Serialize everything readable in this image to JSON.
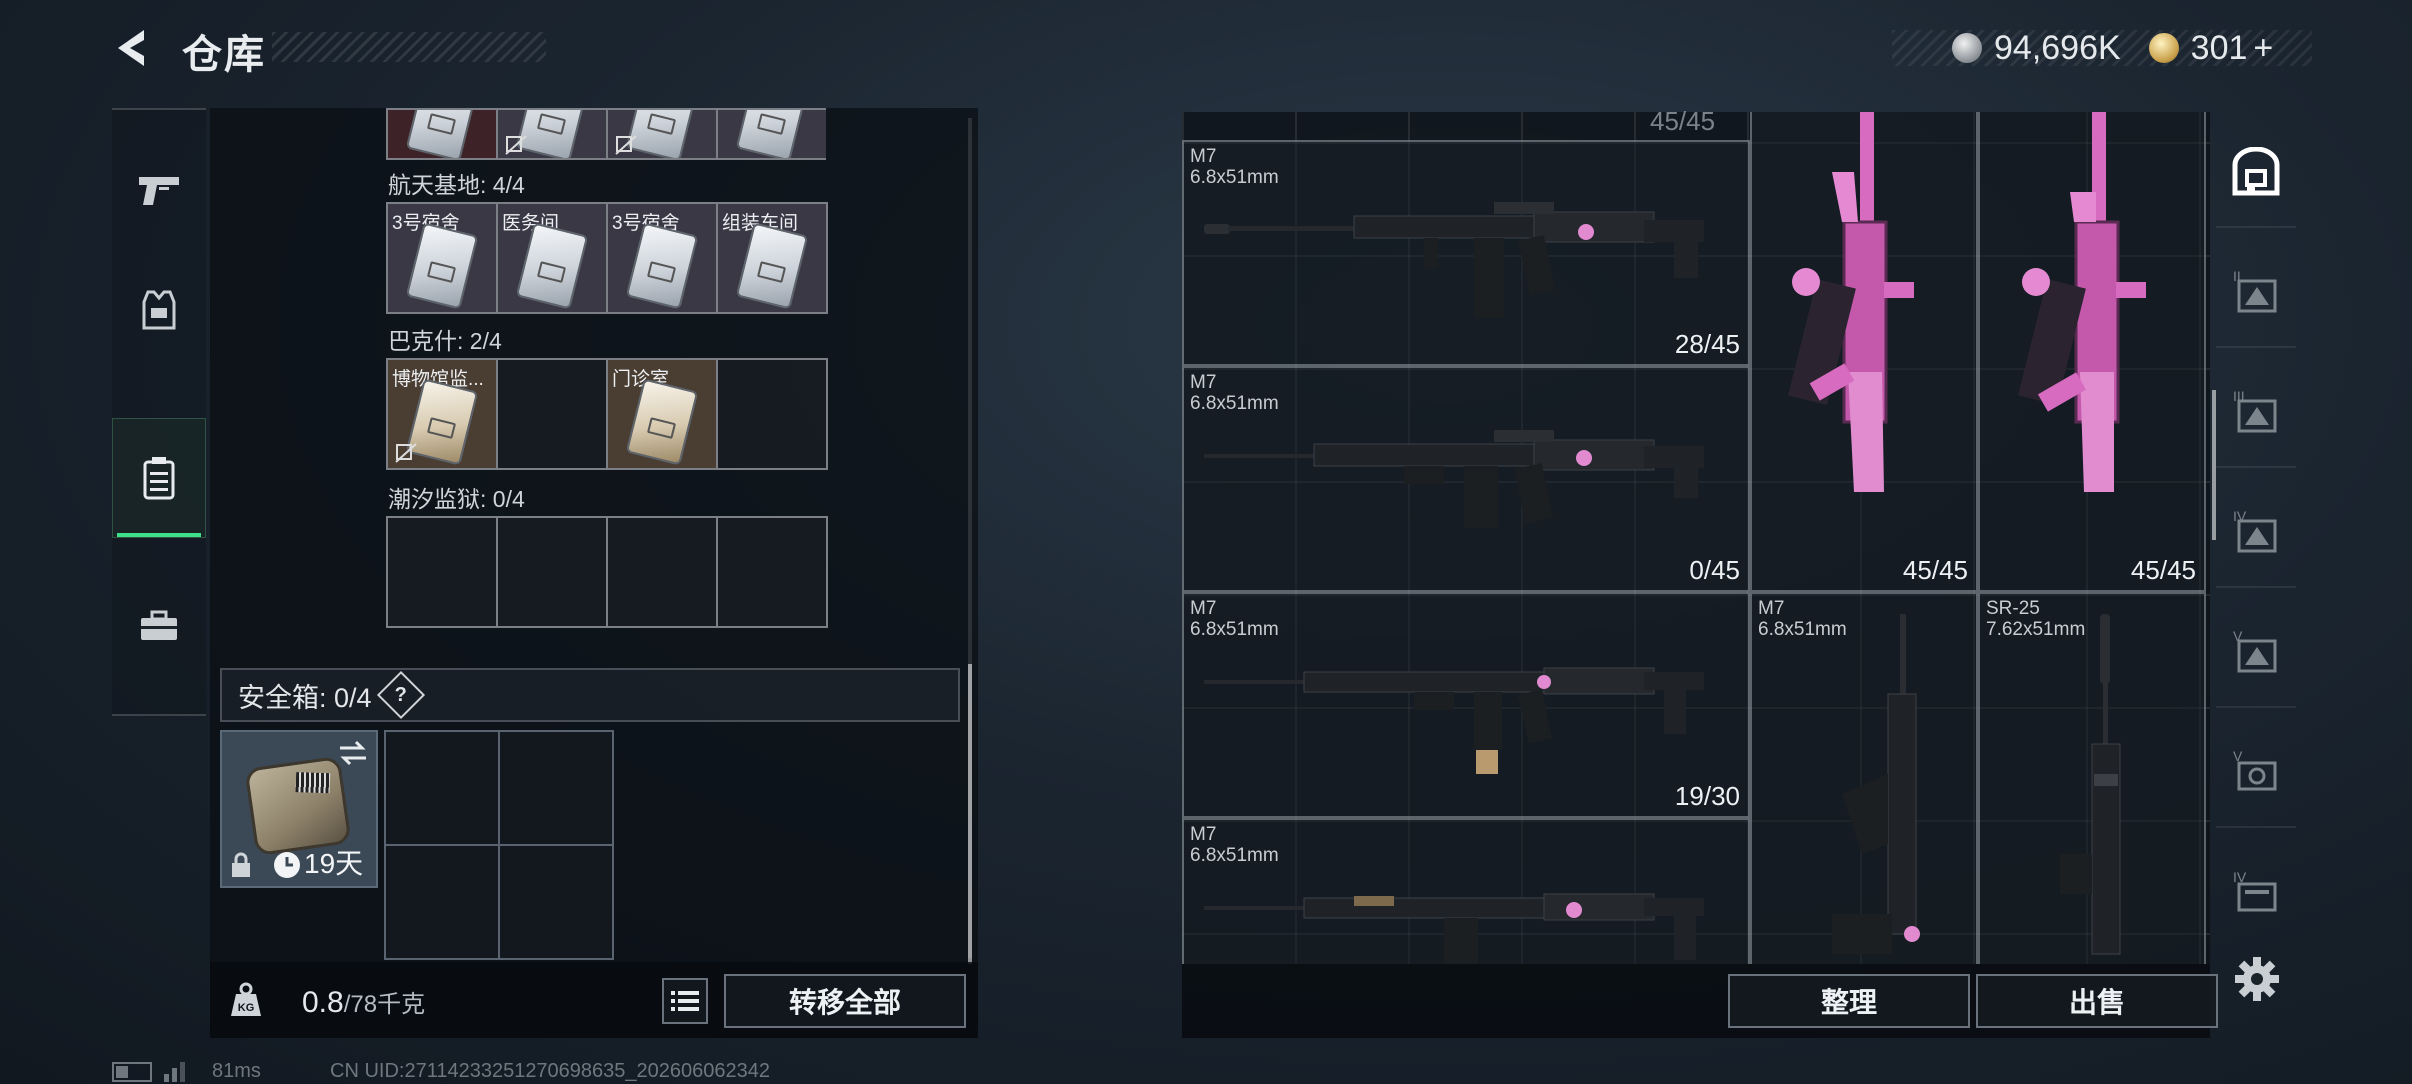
{
  "header": {
    "title": "仓库",
    "silver_amount": "94,696K",
    "gold_amount": "301",
    "gold_plus": "+"
  },
  "left_rail": {
    "items": [
      {
        "icon": "pistol-icon"
      },
      {
        "icon": "vest-icon"
      },
      {
        "icon": "keycard-case-icon",
        "active": true
      },
      {
        "icon": "briefcase-icon"
      }
    ]
  },
  "keys": {
    "groups": [
      {
        "label": "航天基地: 4/4",
        "cells": [
          "3号宿舍",
          "医务间",
          "3号宿舍",
          "组装车间"
        ]
      },
      {
        "label": "巴克什: 2/4",
        "cells": [
          "博物馆监...",
          "",
          "门诊室",
          ""
        ]
      },
      {
        "label": "潮汐监狱: 0/4",
        "cells": [
          "",
          "",
          "",
          ""
        ]
      }
    ]
  },
  "safe_box": {
    "label": "安全箱: 0/4",
    "help": "?",
    "duration": "19天"
  },
  "weight": {
    "current": "0.8",
    "max": "/78千克",
    "icon_label": "KG"
  },
  "buttons": {
    "transfer_all": "转移全部",
    "sort": "整理",
    "sell": "出售"
  },
  "inventory": {
    "top_partial_ammo": "45/45",
    "weapons": [
      {
        "name": "M7",
        "caliber": "6.8x51mm",
        "ammo": "28/45"
      },
      {
        "name": "M7",
        "caliber": "6.8x51mm",
        "ammo": "0/45"
      },
      {
        "name": "M7",
        "caliber": "6.8x51mm",
        "ammo": "19/30"
      },
      {
        "name": "M7",
        "caliber": "6.8x51mm",
        "ammo": ""
      },
      {
        "name": "",
        "caliber": "",
        "ammo": "45/45"
      },
      {
        "name": "",
        "caliber": "",
        "ammo": "45/45"
      },
      {
        "name": "M7",
        "caliber": "6.8x51mm",
        "ammo": ""
      },
      {
        "name": "SR-25",
        "caliber": "7.62x51mm",
        "ammo": ""
      }
    ]
  },
  "right_rail": {
    "tiers": [
      "",
      "II",
      "III",
      "IV",
      "V",
      "IV"
    ]
  },
  "footer": {
    "ping": "81ms",
    "uid": "CN UID:27114233251270698635_202606062342"
  }
}
